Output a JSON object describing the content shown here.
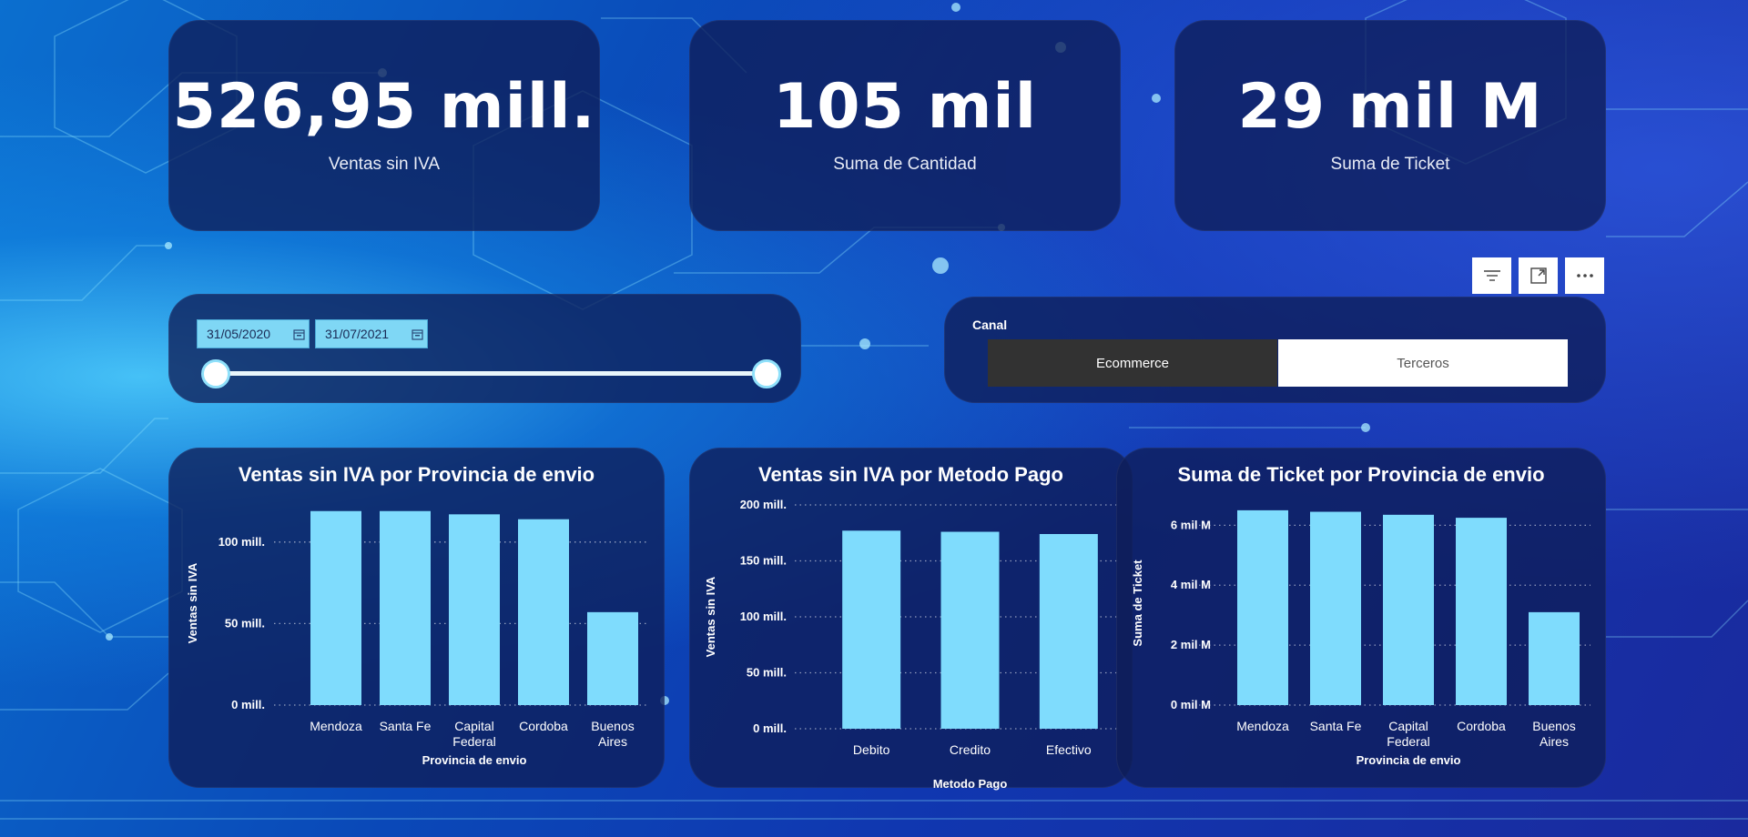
{
  "kpis": [
    {
      "value": "526,95 mill.",
      "label": "Ventas sin IVA"
    },
    {
      "value": "105 mil",
      "label": "Suma de Cantidad"
    },
    {
      "value": "29 mil M",
      "label": "Suma de Ticket"
    }
  ],
  "date_slicer": {
    "start": "31/05/2020",
    "end": "31/07/2021",
    "range": [
      0,
      1
    ]
  },
  "toolbar": {
    "icons": [
      "filter-icon",
      "focus-mode-icon",
      "more-options-icon"
    ]
  },
  "canal": {
    "title": "Canal",
    "options": [
      "Ecommerce",
      "Terceros"
    ],
    "selected": "Ecommerce"
  },
  "colors": {
    "bar": "#7fdcfd",
    "card": "#0e1e58",
    "selected": "#323232"
  },
  "chart_data": [
    {
      "type": "bar",
      "title": "Ventas sin IVA por Provincia de envio",
      "xlabel": "Provincia de envio",
      "ylabel": "Ventas sin IVA",
      "categories": [
        "Mendoza",
        "Santa Fe",
        "Capital Federal",
        "Cordoba",
        "Buenos Aires"
      ],
      "category_lines": [
        [
          "Mendoza"
        ],
        [
          "Santa Fe"
        ],
        [
          "Capital",
          "Federal"
        ],
        [
          "Cordoba"
        ],
        [
          "Buenos",
          "Aires"
        ]
      ],
      "values": [
        119,
        119,
        117,
        114,
        57
      ],
      "ylim": [
        0,
        125
      ],
      "yticks": [
        0,
        50,
        100
      ],
      "ytick_labels": [
        "0 mill.",
        "50 mill.",
        "100 mill."
      ],
      "grid": true
    },
    {
      "type": "bar",
      "title": "Ventas sin IVA por Metodo Pago",
      "xlabel": "Metodo Pago",
      "ylabel": "Ventas sin IVA",
      "categories": [
        "Debito",
        "Credito",
        "Efectivo"
      ],
      "category_lines": [
        [
          "Debito"
        ],
        [
          "Credito"
        ],
        [
          "Efectivo"
        ]
      ],
      "values": [
        177,
        176,
        174
      ],
      "ylim": [
        0,
        200
      ],
      "yticks": [
        0,
        50,
        100,
        150,
        200
      ],
      "ytick_labels": [
        "0 mill.",
        "50 mill.",
        "100 mill.",
        "150 mill.",
        "200 mill."
      ],
      "grid": true
    },
    {
      "type": "bar",
      "title": "Suma de Ticket por Provincia de envio",
      "xlabel": "Provincia de envio",
      "ylabel": "Suma de Ticket",
      "categories": [
        "Mendoza",
        "Santa Fe",
        "Capital Federal",
        "Cordoba",
        "Buenos Aires"
      ],
      "category_lines": [
        [
          "Mendoza"
        ],
        [
          "Santa Fe"
        ],
        [
          "Capital",
          "Federal"
        ],
        [
          "Cordoba"
        ],
        [
          "Buenos",
          "Aires"
        ]
      ],
      "values": [
        6.5,
        6.45,
        6.35,
        6.25,
        3.1
      ],
      "ylim": [
        0,
        6.8
      ],
      "yticks": [
        0,
        2,
        4,
        6
      ],
      "ytick_labels": [
        "0 mil M",
        "2 mil M",
        "4 mil M",
        "6 mil M"
      ],
      "grid": true
    }
  ]
}
